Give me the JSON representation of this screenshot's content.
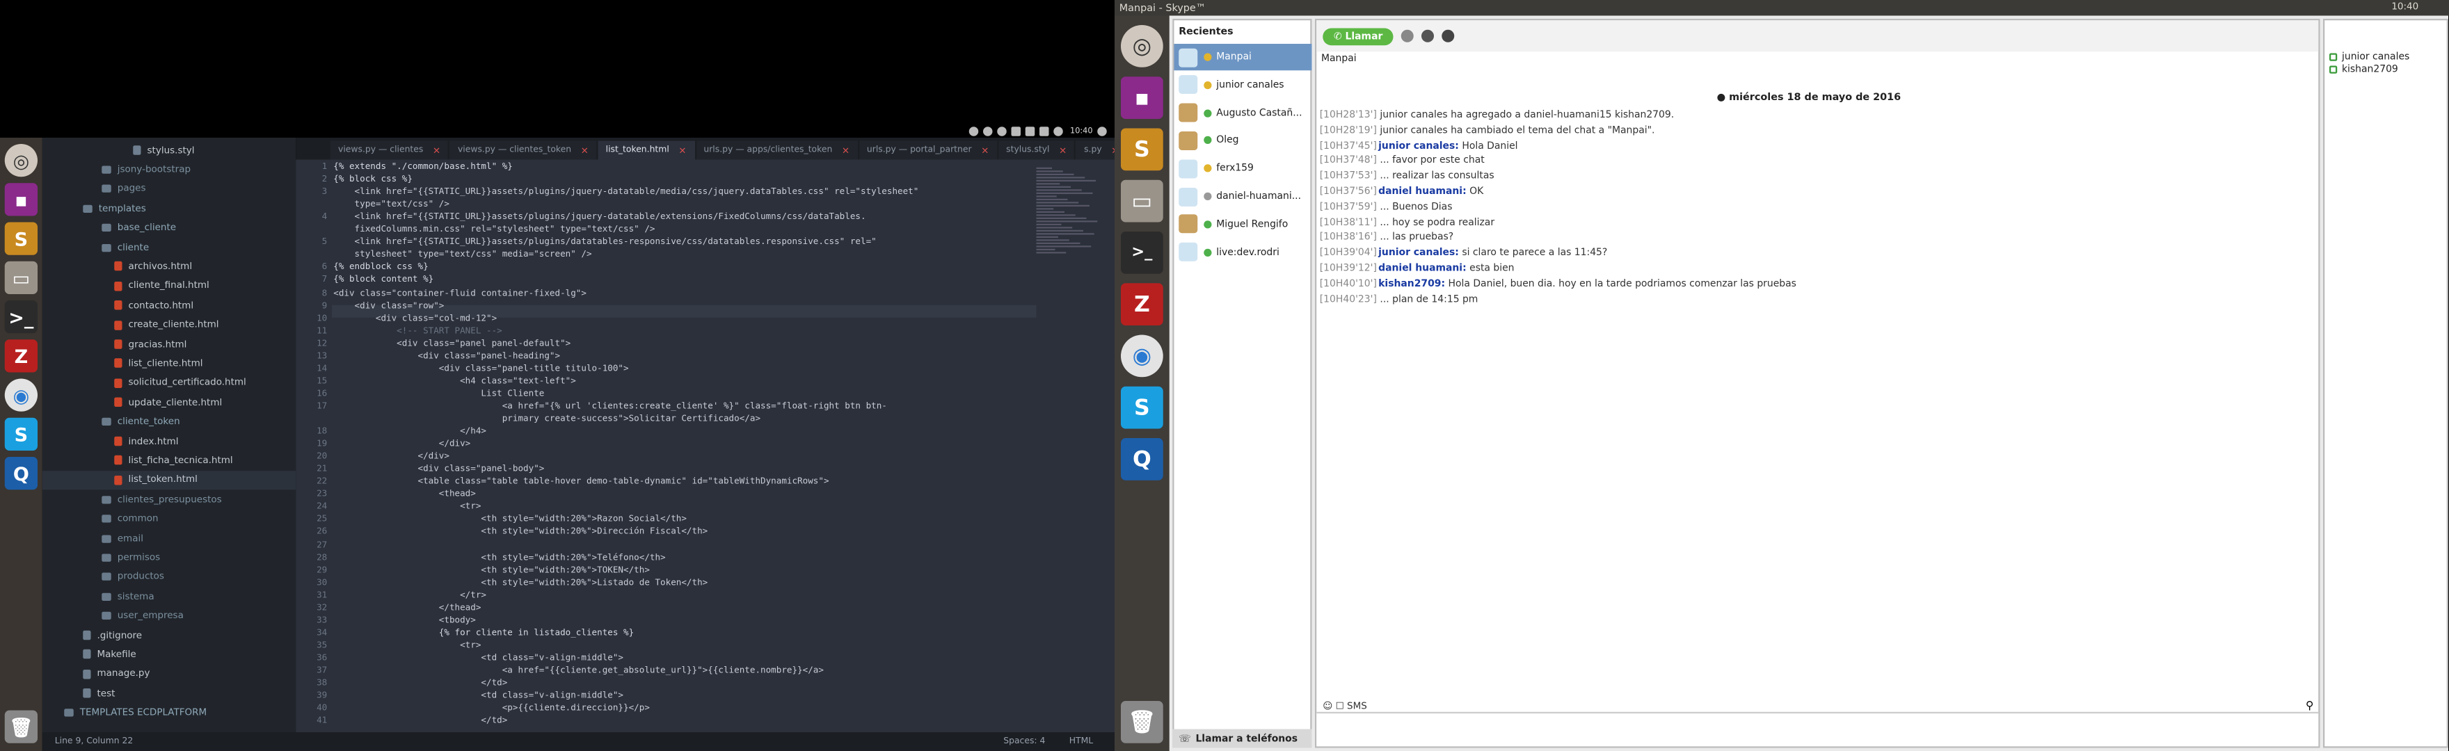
{
  "left_panel": {
    "tray_time": "10:40",
    "sidebar": {
      "items": [
        {
          "label": "stylus.styl",
          "kind": "file"
        },
        {
          "label": "jsony-bootstrap",
          "kind": "folder"
        },
        {
          "label": "pages",
          "kind": "folder"
        },
        {
          "label": "templates",
          "kind": "folder"
        },
        {
          "label": "base_cliente",
          "kind": "folder"
        },
        {
          "label": "cliente",
          "kind": "folder"
        },
        {
          "label": "archivos.html",
          "kind": "file"
        },
        {
          "label": "cliente_final.html",
          "kind": "file"
        },
        {
          "label": "contacto.html",
          "kind": "file"
        },
        {
          "label": "create_cliente.html",
          "kind": "file"
        },
        {
          "label": "gracias.html",
          "kind": "file"
        },
        {
          "label": "list_cliente.html",
          "kind": "file"
        },
        {
          "label": "solicitud_certificado.html",
          "kind": "file"
        },
        {
          "label": "update_cliente.html",
          "kind": "file"
        },
        {
          "label": "cliente_token",
          "kind": "folder"
        },
        {
          "label": "index.html",
          "kind": "file"
        },
        {
          "label": "list_ficha_tecnica.html",
          "kind": "file"
        },
        {
          "label": "list_token.html",
          "kind": "file"
        },
        {
          "label": "clientes_presupuestos",
          "kind": "folder"
        },
        {
          "label": "common",
          "kind": "folder"
        },
        {
          "label": "email",
          "kind": "folder"
        },
        {
          "label": "permisos",
          "kind": "folder"
        },
        {
          "label": "productos",
          "kind": "folder"
        },
        {
          "label": "sistema",
          "kind": "folder"
        },
        {
          "label": "user_empresa",
          "kind": "folder"
        },
        {
          "label": ".gitignore",
          "kind": "file"
        },
        {
          "label": "Makefile",
          "kind": "file"
        },
        {
          "label": "manage.py",
          "kind": "file"
        },
        {
          "label": "test",
          "kind": "file"
        },
        {
          "label": "TEMPLATES ECDPLATFORM",
          "kind": "folder"
        }
      ]
    },
    "tabs": [
      {
        "label": "views.py — clientes",
        "active": false
      },
      {
        "label": "views.py — clientes_token",
        "active": false
      },
      {
        "label": "list_token.html",
        "active": true
      },
      {
        "label": "urls.py — apps/clientes_token",
        "active": false
      },
      {
        "label": "urls.py — portal_partner",
        "active": false
      },
      {
        "label": "stylus.styl",
        "active": false
      },
      {
        "label": "s.py",
        "active": false
      }
    ],
    "code_lines": [
      "{% extends \"./common/base.html\" %}",
      "{% block css %}",
      "    <link href=\"{{STATIC_URL}}assets/plugins/jquery-datatable/media/css/jquery.dataTables.css\" rel=\"stylesheet\"",
      "    type=\"text/css\" />",
      "    <link href=\"{{STATIC_URL}}assets/plugins/jquery-datatable/extensions/FixedColumns/css/dataTables.",
      "    fixedColumns.min.css\" rel=\"stylesheet\" type=\"text/css\" />",
      "    <link href=\"{{STATIC_URL}}assets/plugins/datatables-responsive/css/datatables.responsive.css\" rel=\"",
      "    stylesheet\" type=\"text/css\" media=\"screen\" />",
      "{% endblock css %}",
      "{% block content %}",
      "<div class=\"container-fluid container-fixed-lg\">",
      "    <div class=\"row\">",
      "        <div class=\"col-md-12\">",
      "            <!-- START PANEL -->",
      "            <div class=\"panel panel-default\">",
      "                <div class=\"panel-heading\">",
      "                    <div class=\"panel-title titulo-100\">",
      "                        <h4 class=\"text-left\">",
      "                            List Cliente",
      "                                <a href=\"{% url 'clientes:create_cliente' %}\" class=\"float-right btn btn-",
      "                                primary create-success\">Solicitar Certificado</a>",
      "                        </h4>",
      "                    </div>",
      "                </div>",
      "                <div class=\"panel-body\">",
      "                <table class=\"table table-hover demo-table-dynamic\" id=\"tableWithDynamicRows\">",
      "                    <thead>",
      "                        <tr>",
      "                            <th style=\"width:20%\">Razon Social</th>",
      "                            <th style=\"width:20%\">Dirección Fiscal</th>",
      "",
      "                            <th style=\"width:20%\">Teléfono</th>",
      "                            <th style=\"width:20%\">TOKEN</th>",
      "                            <th style=\"width:20%\">Listado de Token</th>",
      "                        </tr>",
      "                    </thead>",
      "                    <tbody>",
      "                    {% for cliente in listado_clientes %}",
      "                        <tr>",
      "                            <td class=\"v-align-middle\">",
      "                                <a href=\"{{cliente.get_absolute_url}}\">{{cliente.nombre}}</a>",
      "                            </td>",
      "                            <td class=\"v-align-middle\">",
      "                                <p>{{cliente.direccion}}</p>",
      "                            </td>"
    ],
    "line_numbers": [
      "1",
      "2",
      "3",
      "",
      "4",
      "",
      "5",
      "",
      "6",
      "7",
      "8",
      "9",
      "10",
      "11",
      "12",
      "13",
      "14",
      "15",
      "16",
      "17",
      "",
      "18",
      "19",
      "20",
      "21",
      "22",
      "23",
      "24",
      "25",
      "26",
      "27",
      "28",
      "29",
      "30",
      "31",
      "32",
      "33",
      "34",
      "35",
      "36",
      "37",
      "38",
      "39",
      "40",
      "41"
    ],
    "status": {
      "left": "Line 9, Column 22",
      "spaces": "Spaces: 4",
      "syntax": "HTML"
    }
  },
  "right_panel": {
    "window_title": "Manpai - Skype™",
    "tray_time": "10:40",
    "recent_header": "Recientes",
    "recents": [
      {
        "name": "Manpai",
        "selected": true
      },
      {
        "name": "junior canales",
        "selected": false
      },
      {
        "name": "Augusto Castañ...",
        "selected": false
      },
      {
        "name": "Oleg",
        "selected": false
      },
      {
        "name": "ferx159",
        "selected": false
      },
      {
        "name": "daniel-huamani...",
        "selected": false
      },
      {
        "name": "Miguel Rengifo",
        "selected": false
      },
      {
        "name": "live:dev.rodri",
        "selected": false
      }
    ],
    "call_button": "Llamar",
    "chat_name": "Manpai",
    "date_separator": "miércoles 18 de mayo de 2016",
    "messages": [
      {
        "time": "[10H28'13']",
        "author": "",
        "text": "junior canales ha agregado a daniel-huamani15 kishan2709."
      },
      {
        "time": "[10H28'19']",
        "author": "",
        "text": "junior canales ha cambiado el tema del chat a \"Manpai\"."
      },
      {
        "time": "[10H37'45']",
        "author": "junior canales:",
        "text": "Hola Daniel"
      },
      {
        "time": "[10H37'48']",
        "author": "",
        "text": "... favor por este chat"
      },
      {
        "time": "[10H37'53']",
        "author": "",
        "text": "... realizar las consultas"
      },
      {
        "time": "[10H37'56']",
        "author": "daniel huamani:",
        "text": "OK"
      },
      {
        "time": "[10H37'59']",
        "author": "",
        "text": "... Buenos Dias"
      },
      {
        "time": "[10H38'11']",
        "author": "",
        "text": "... hoy se podra realizar"
      },
      {
        "time": "[10H38'16']",
        "author": "",
        "text": "... las pruebas?"
      },
      {
        "time": "[10H39'04']",
        "author": "junior canales:",
        "text": "si claro te parece a las 11:45?"
      },
      {
        "time": "[10H39'12']",
        "author": "daniel huamani:",
        "text": "esta bien"
      },
      {
        "time": "[10H40'10']",
        "author": "kishan2709:",
        "text": "Hola Daniel, buen dia. hoy en la tarde podriamos comenzar las pruebas"
      },
      {
        "time": "[10H40'23']",
        "author": "",
        "text": "... plan de 14:15 pm"
      }
    ],
    "sms_label": "SMS",
    "call_phones": "Llamar a teléfonos",
    "members": [
      "junior canales",
      "kishan2709"
    ]
  }
}
